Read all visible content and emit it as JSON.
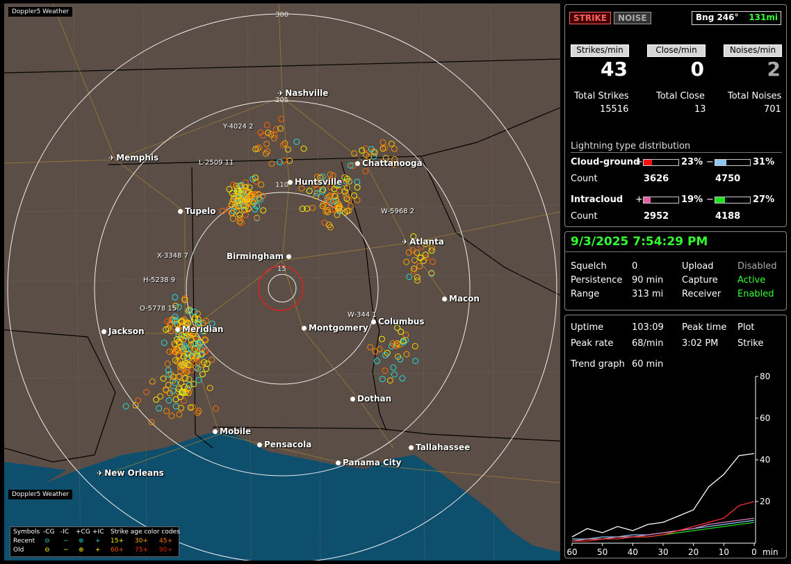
{
  "brand": "Doppler5 Weather",
  "map": {
    "cities": [
      {
        "name": "Nashville",
        "type": "airport"
      },
      {
        "name": "Memphis",
        "type": "airport"
      },
      {
        "name": "Chattanooga",
        "type": "city"
      },
      {
        "name": "Huntsville",
        "type": "city"
      },
      {
        "name": "Tupelo",
        "type": "city"
      },
      {
        "name": "Birmingham",
        "type": "city"
      },
      {
        "name": "Atlanta",
        "type": "airport"
      },
      {
        "name": "Macon",
        "type": "city"
      },
      {
        "name": "Jackson",
        "type": "city"
      },
      {
        "name": "Meridian",
        "type": "city"
      },
      {
        "name": "Montgomery",
        "type": "city"
      },
      {
        "name": "Columbus",
        "type": "city"
      },
      {
        "name": "Dothan",
        "type": "city"
      },
      {
        "name": "Mobile",
        "type": "city"
      },
      {
        "name": "Pensacola",
        "type": "city"
      },
      {
        "name": "Tallahassee",
        "type": "city"
      },
      {
        "name": "Panama City",
        "type": "city"
      },
      {
        "name": "New Orleans",
        "type": "airport"
      }
    ],
    "stations": [
      "Y-4024 2",
      "L-2509 11",
      "W-5968 2",
      "X-3348 7",
      "H-5238 9",
      "O-5778 15",
      "W-344 1"
    ],
    "range_labels": [
      "300",
      "205",
      "110",
      "15"
    ]
  },
  "legend": {
    "header": [
      "Symbols",
      "-CG",
      "-IC",
      "+CG",
      "+IC",
      "Strike age color codes"
    ],
    "recent": {
      "label": "Recent",
      "ages": [
        "15+",
        "30+",
        "45+"
      ]
    },
    "old": {
      "label": "Old",
      "ages": [
        "60+",
        "75+",
        "90+"
      ]
    },
    "age_colors": [
      "#ffee00",
      "#ffaa00",
      "#ff7700",
      "#ff5500",
      "#ff3300",
      "#dd2200"
    ]
  },
  "top": {
    "strike_button": "STRIKE",
    "noise_button": "NOISE",
    "bearing": "Bng 246°",
    "distance": "131mi",
    "headers": [
      "Strikes/min",
      "Close/min",
      "Noises/min"
    ],
    "big_values": [
      "43",
      "0",
      "2"
    ],
    "totals_labels": [
      "Total Strikes",
      "Total Close",
      "Total Noises"
    ],
    "totals_values": [
      "15516",
      "13",
      "701"
    ],
    "dist_title": "Lightning type distribution",
    "cg_label": "Cloud-ground",
    "ic_label": "Intracloud",
    "count_label": "Count",
    "cg_pos_pct": "23%",
    "cg_neg_pct": "31%",
    "cg_pos_count": "3626",
    "cg_neg_count": "4750",
    "ic_pos_pct": "19%",
    "ic_neg_pct": "27%",
    "ic_pos_count": "2952",
    "ic_neg_count": "4188",
    "plus": "+",
    "minus": "−",
    "bar_fractions": {
      "cg_pos": 0.23,
      "cg_neg": 0.31,
      "ic_pos": 0.19,
      "ic_neg": 0.27
    },
    "bar_colors": {
      "cg_pos": "#ff1010",
      "cg_neg": "#8ec8f0",
      "ic_pos": "#e060a0",
      "ic_neg": "#20e020"
    }
  },
  "status": {
    "datetime": "9/3/2025 7:54:29 PM",
    "squelch_label": "Squelch",
    "squelch_value": "0",
    "persistence_label": "Persistence",
    "persistence_value": "90 min",
    "range_label": "Range",
    "range_value": "313 mi",
    "upload_label": "Upload",
    "upload_value": "Disabled",
    "capture_label": "Capture",
    "capture_value": "Active",
    "receiver_label": "Receiver",
    "receiver_value": "Enabled"
  },
  "trend": {
    "uptime_label": "Uptime",
    "uptime_value": "103:09",
    "peak_time_label": "Peak time",
    "peak_time_value": "3:02 PM",
    "plot_label": "Plot",
    "plot_value": "Strike",
    "peak_rate_label": "Peak rate",
    "peak_rate_value": "68/min",
    "trend_label": "Trend graph",
    "trend_value": "60 min",
    "chart_data": {
      "type": "line",
      "x": [
        60,
        55,
        50,
        45,
        40,
        35,
        30,
        25,
        20,
        15,
        10,
        5,
        0
      ],
      "xlabel": "min",
      "x_ticks": [
        "60",
        "50",
        "40",
        "30",
        "20",
        "10",
        "0"
      ],
      "y_ticks": [
        "80",
        "60",
        "40",
        "20"
      ],
      "ylim": [
        0,
        80
      ],
      "series": [
        {
          "color": "#ffffff",
          "values": [
            3,
            7,
            5,
            8,
            6,
            9,
            10,
            13,
            16,
            27,
            33,
            42,
            43
          ]
        },
        {
          "color": "#ff3030",
          "values": [
            1,
            1,
            2,
            2,
            3,
            3,
            4,
            6,
            8,
            10,
            12,
            18,
            20
          ]
        },
        {
          "color": "#e080c0",
          "values": [
            1,
            2,
            2,
            3,
            3,
            4,
            5,
            6,
            7,
            9,
            10,
            11,
            12
          ]
        },
        {
          "color": "#20e020",
          "values": [
            1,
            2,
            2,
            3,
            3,
            3,
            4,
            5,
            6,
            7,
            8,
            9,
            10
          ]
        },
        {
          "color": "#8ec8f0",
          "values": [
            2,
            2,
            3,
            3,
            4,
            4,
            5,
            6,
            7,
            8,
            9,
            10,
            11
          ]
        }
      ]
    }
  }
}
